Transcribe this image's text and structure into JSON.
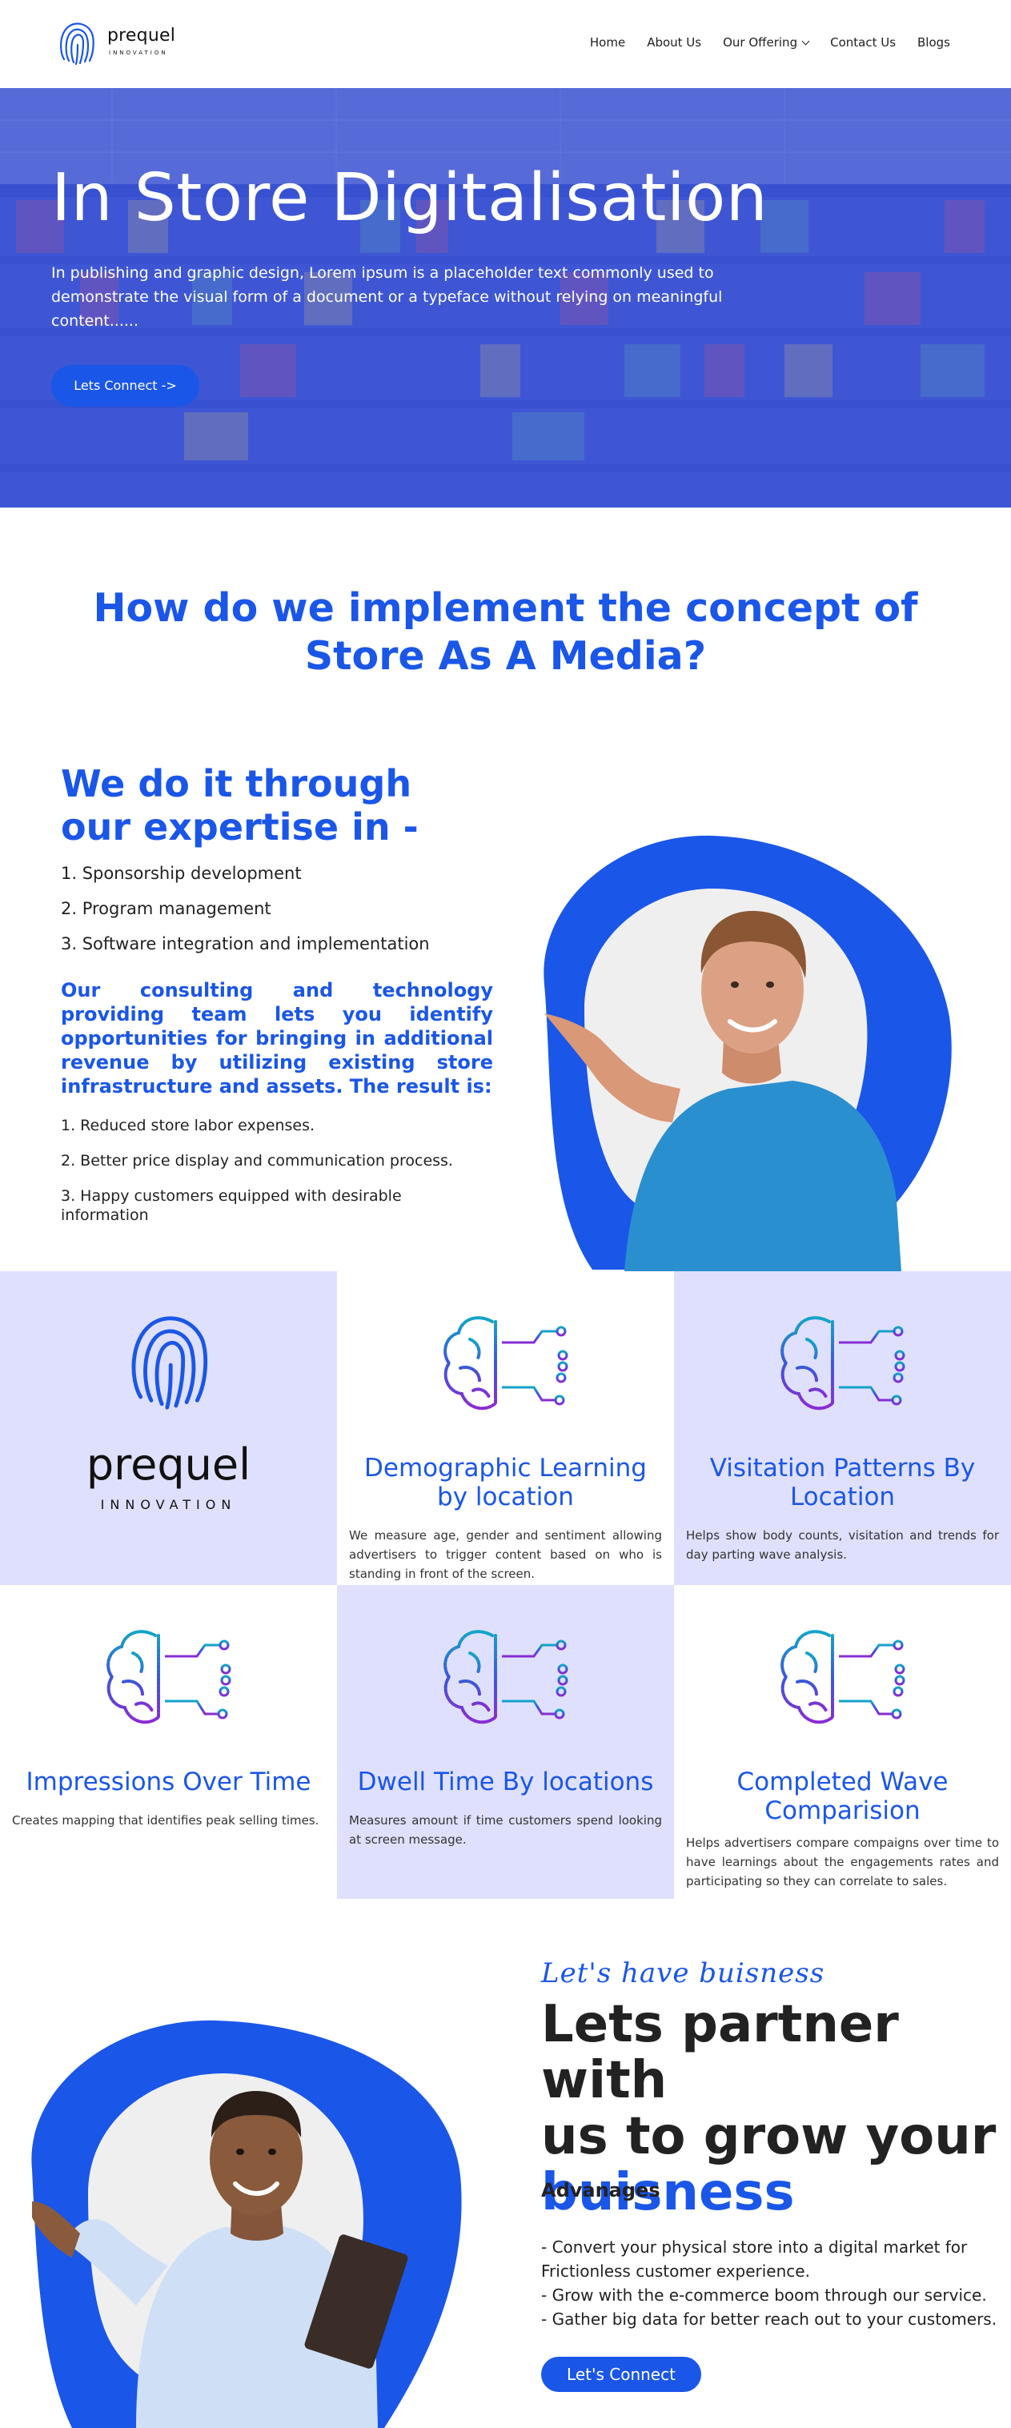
{
  "header": {
    "logo_word": "prequel",
    "logo_sub": "INNOVATION",
    "nav": [
      "Home",
      "About Us",
      "Our Offering",
      "Contact Us",
      "Blogs"
    ]
  },
  "hero": {
    "title": "In Store Digitalisation",
    "text": "In publishing and graphic design, Lorem ipsum is a placeholder text commonly used to demonstrate the visual form of a document or a typeface without relying on meaningful content......",
    "button": "Lets Connect ->"
  },
  "how": {
    "title": "How do we implement the concept of Store As A Media?"
  },
  "expertise": {
    "title": "We do it through our expertise in -",
    "items": [
      "1. Sponsorship development",
      "2. Program management",
      "3. Software integration and implementation"
    ],
    "para": "Our consulting and technology providing team lets you identify opportunities for bringing in additional revenue by utilizing existing store infrastructure and assets. The result is:",
    "results": [
      "1. Reduced store labor expenses.",
      "2. Better price display and communication process.",
      "3. Happy customers equipped with desirable information"
    ]
  },
  "grid": {
    "brand_word": "prequel",
    "brand_sub": "INNOVATION",
    "cards": [
      {
        "title": "Demographic Learning by location",
        "text": "We measure age, gender and sentiment allowing advertisers to trigger content based on who is standing in front of the screen."
      },
      {
        "title": "Visitation Patterns By Location",
        "text": "Helps show body counts, visitation and trends for day parting wave analysis."
      },
      {
        "title": "Impressions Over Time",
        "text": "Creates mapping that identifies peak selling times."
      },
      {
        "title": "Dwell Time By locations",
        "text": "Measures amount if time customers spend looking at screen message."
      },
      {
        "title": "Completed Wave Comparision",
        "text": "Helps advertisers compare compaigns over time to have learnings about the engagements rates and participating so they can correlate to sales."
      }
    ]
  },
  "partner": {
    "script": "Let's have buisness",
    "line1": "Lets partner with",
    "line2": "us to grow your",
    "line3": "buisness",
    "adv_title": "Advanages",
    "adv_lines": [
      "- Convert your physical store into a digital market for Frictionless customer experience.",
      "- Grow with the e-commerce boom through our service.",
      "- Gather big data for better reach out to your customers."
    ],
    "button": "Let's Connect"
  },
  "colors": {
    "accent": "#1a56e8",
    "lavender": "#dfe0fd"
  }
}
